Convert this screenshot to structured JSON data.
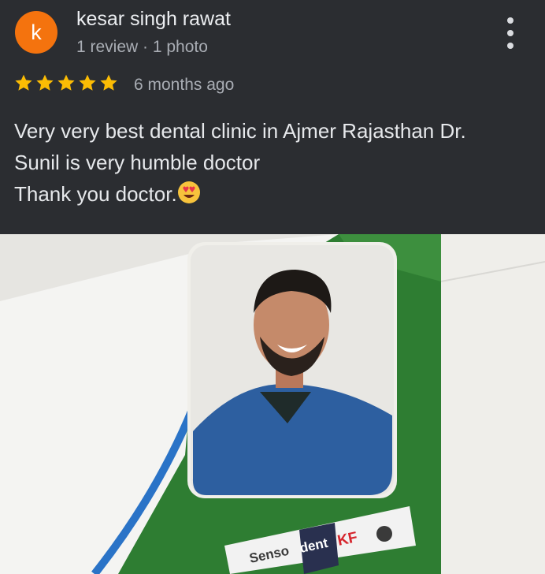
{
  "reviewer": {
    "initial": "k",
    "name": "kesar singh rawat",
    "meta": "1 review · 1 photo"
  },
  "rating": {
    "stars": 5,
    "max": 5,
    "time": "6 months ago"
  },
  "review_text": {
    "line1": "Very very best dental clinic in Ajmer Rajasthan Dr.",
    "line2": "Sunil is very humble doctor",
    "line3": "Thank you doctor."
  },
  "photo": {
    "product_name_part1": "Senso",
    "product_name_part2": "dent",
    "product_name_part3": "KF"
  },
  "colors": {
    "background": "#2b2d31",
    "avatar": "#f4730e",
    "star": "#fbbc04",
    "clinic_green": "#2e7d32"
  },
  "icons": {
    "more": "more-vertical-icon",
    "star": "star-icon",
    "emoji": "heart-eyes-emoji-icon"
  }
}
